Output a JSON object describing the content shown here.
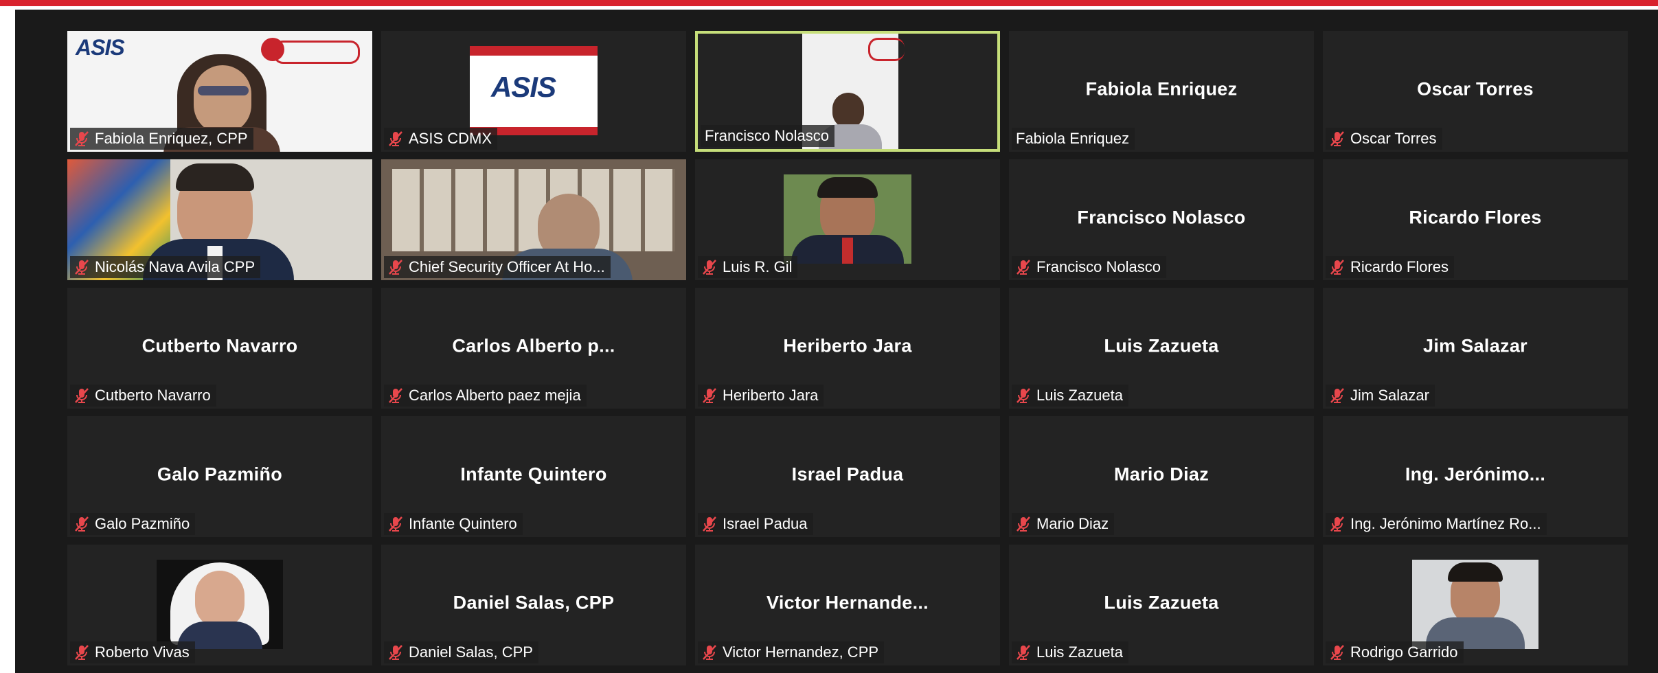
{
  "app": {
    "accent": "#d9232e",
    "active_speaker_border": "#c6de7a"
  },
  "tiles": [
    {
      "center": "",
      "plate": "Fabiola Enriquez, CPP",
      "muted": true,
      "video": "fabiola-video"
    },
    {
      "center": "",
      "plate": "ASIS CDMX",
      "muted": true,
      "video": "asis-logo-video",
      "logo": "ASIS"
    },
    {
      "center": "",
      "plate": "Francisco Nolasco",
      "muted": false,
      "video": "francisco-video",
      "active": true
    },
    {
      "center": "Fabiola Enriquez",
      "plate": "Fabiola Enriquez",
      "muted": false
    },
    {
      "center": "Oscar Torres",
      "plate": "Oscar Torres",
      "muted": true
    },
    {
      "center": "",
      "plate": "Nicolás Nava Avila CPP",
      "muted": true,
      "video": "nicolas-video"
    },
    {
      "center": "",
      "plate": "Chief Security Officer At Ho...",
      "muted": true,
      "video": "cso-video"
    },
    {
      "center": "",
      "plate": "Luis R. Gil",
      "muted": true,
      "video": "luis-gil-photo"
    },
    {
      "center": "Francisco Nolasco",
      "plate": "Francisco Nolasco",
      "muted": true
    },
    {
      "center": "Ricardo Flores",
      "plate": "Ricardo Flores",
      "muted": true
    },
    {
      "center": "Cutberto Navarro",
      "plate": "Cutberto Navarro",
      "muted": true
    },
    {
      "center": "Carlos  Alberto  p...",
      "plate": "Carlos Alberto paez mejia",
      "muted": true
    },
    {
      "center": "Heriberto Jara",
      "plate": "Heriberto Jara",
      "muted": true
    },
    {
      "center": "Luis Zazueta",
      "plate": "Luis Zazueta",
      "muted": true
    },
    {
      "center": "Jim Salazar",
      "plate": "Jim Salazar",
      "muted": true
    },
    {
      "center": "Galo Pazmiño",
      "plate": "Galo Pazmiño",
      "muted": true
    },
    {
      "center": "Infante Quintero",
      "plate": "Infante Quintero",
      "muted": true
    },
    {
      "center": "Israel Padua",
      "plate": "Israel Padua",
      "muted": true
    },
    {
      "center": "Mario Diaz",
      "plate": "Mario Diaz",
      "muted": true
    },
    {
      "center": "Ing.  Jerónimo...",
      "plate": "Ing. Jerónimo Martínez Ro...",
      "muted": true
    },
    {
      "center": "",
      "plate": "Roberto Vivas",
      "muted": true,
      "video": "roberto-photo"
    },
    {
      "center": "Daniel Salas, CPP",
      "plate": "Daniel Salas, CPP",
      "muted": true
    },
    {
      "center": "Victor  Hernande...",
      "plate": "Victor Hernandez, CPP",
      "muted": true
    },
    {
      "center": "Luis Zazueta",
      "plate": "Luis Zazueta",
      "muted": true
    },
    {
      "center": "",
      "plate": "Rodrigo Garrido",
      "muted": true,
      "video": "rodrigo-photo"
    }
  ]
}
